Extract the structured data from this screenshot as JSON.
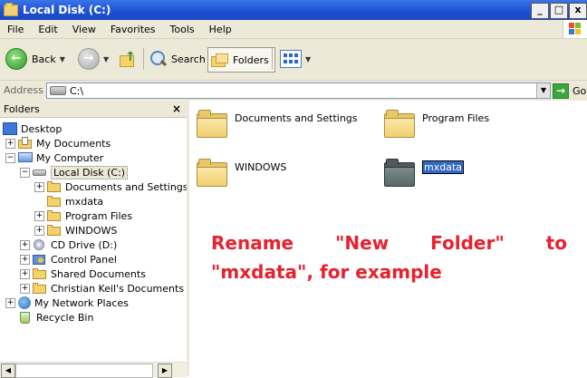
{
  "window": {
    "title": "Local Disk (C:)",
    "min": "_",
    "max": "□",
    "close": "x"
  },
  "menu": [
    "File",
    "Edit",
    "View",
    "Favorites",
    "Tools",
    "Help"
  ],
  "toolbar": {
    "back_label": "Back",
    "search_label": "Search",
    "folders_label": "Folders"
  },
  "address": {
    "label": "Address",
    "value": "C:\\",
    "go_label": "Go"
  },
  "folders_pane": {
    "title": "Folders",
    "close": "×",
    "tree": [
      {
        "label": "Desktop",
        "icon": "desktop-icon"
      },
      {
        "label": "My Documents",
        "icon": "my-documents-icon",
        "expander": "+"
      },
      {
        "label": "My Computer",
        "icon": "my-computer-icon",
        "expander": "−"
      },
      {
        "label": "Local Disk (C:)",
        "icon": "disk-icon",
        "expander": "−",
        "selected": true
      },
      {
        "label": "Documents and Settings",
        "icon": "folder-icon",
        "expander": "+"
      },
      {
        "label": "mxdata",
        "icon": "folder-icon"
      },
      {
        "label": "Program Files",
        "icon": "folder-icon",
        "expander": "+"
      },
      {
        "label": "WINDOWS",
        "icon": "folder-icon",
        "expander": "+"
      },
      {
        "label": "CD Drive (D:)",
        "icon": "cd-drive-icon",
        "expander": "+"
      },
      {
        "label": "Control Panel",
        "icon": "control-panel-icon",
        "expander": "+"
      },
      {
        "label": "Shared Documents",
        "icon": "folder-icon",
        "expander": "+"
      },
      {
        "label": "Christian Keil's Documents",
        "icon": "folder-icon",
        "expander": "+"
      },
      {
        "label": "My Network Places",
        "icon": "network-icon",
        "expander": "+"
      },
      {
        "label": "Recycle Bin",
        "icon": "recycle-bin-icon"
      }
    ]
  },
  "content": {
    "items": [
      {
        "label": "Documents and Settings"
      },
      {
        "label": "Program Files"
      },
      {
        "label": "WINDOWS"
      },
      {
        "label": "mxdata",
        "editing": true
      }
    ]
  },
  "annotation": {
    "words_line1": [
      "Rename",
      "\"New",
      "Folder\"",
      "to"
    ],
    "line2": "\"mxdata\", for example"
  },
  "colors": {
    "annotation": "#e8212e",
    "titlebar": "#1b4fd0",
    "selection": "#316ac5"
  }
}
